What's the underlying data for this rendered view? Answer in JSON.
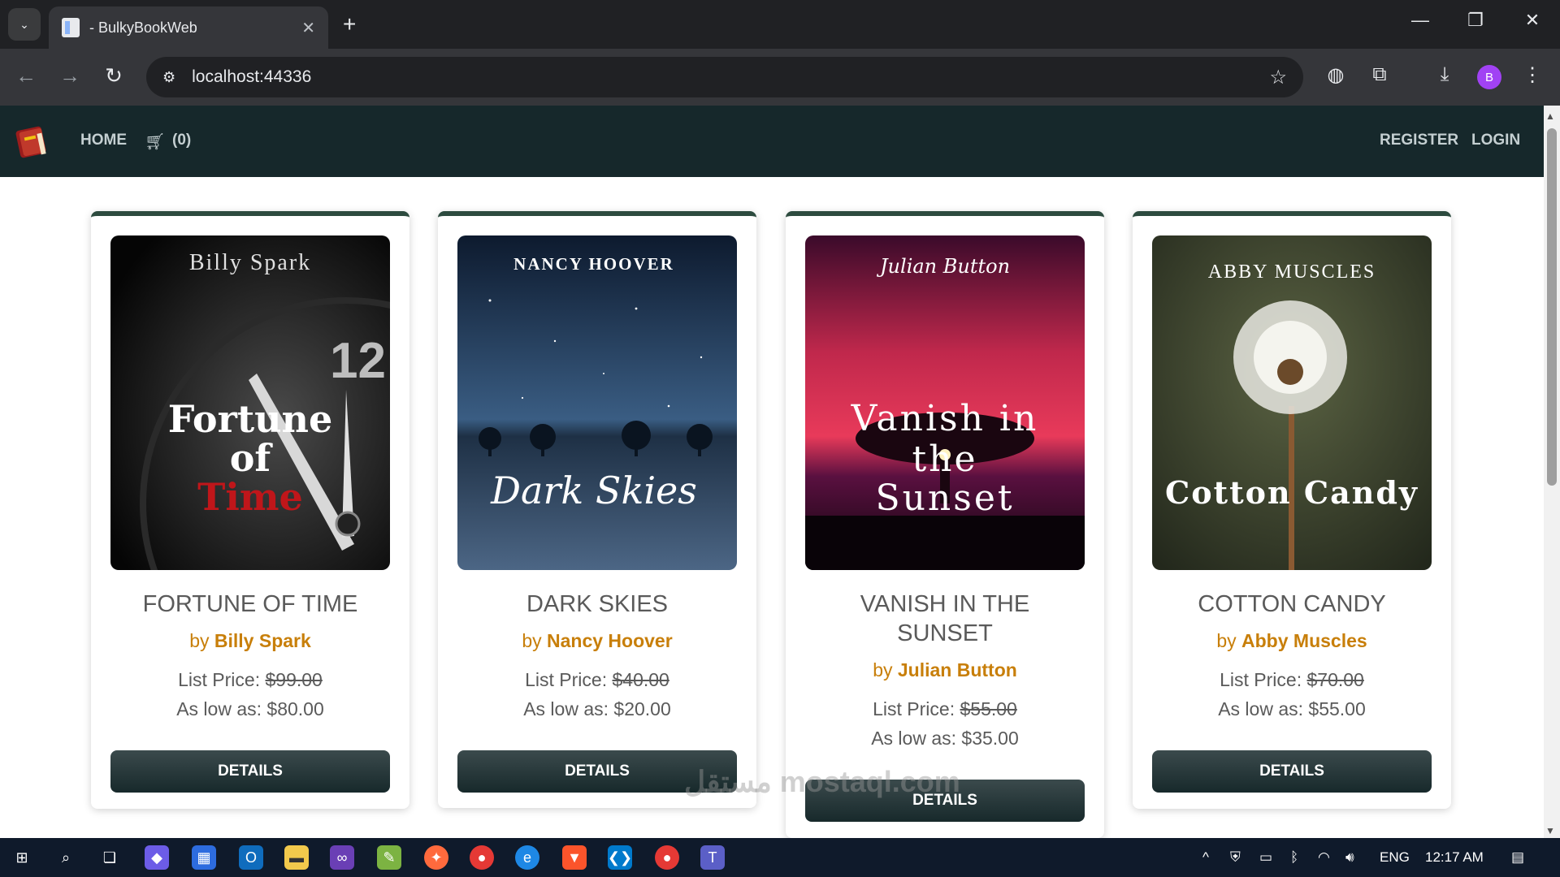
{
  "browser": {
    "tab_title": " - BulkyBookWeb",
    "url": "localhost:44336",
    "profile_initial": "B"
  },
  "nav": {
    "home": "HOME",
    "cart_count": "(0)",
    "register": "REGISTER",
    "login": "LOGIN"
  },
  "products": [
    {
      "title": "FORTUNE OF TIME",
      "by": "by",
      "author": "Billy Spark",
      "list_label": "List Price:",
      "list_price": "$99.00",
      "low_label": "As low as:",
      "low_price": "$80.00",
      "button": "DETAILS",
      "cover_author": "Billy Spark",
      "cover_title_1": "Fortune",
      "cover_title_2": "of",
      "cover_title_3": "Time"
    },
    {
      "title": "DARK SKIES",
      "by": "by",
      "author": "Nancy Hoover",
      "list_label": "List Price:",
      "list_price": "$40.00",
      "low_label": "As low as:",
      "low_price": "$20.00",
      "button": "DETAILS",
      "cover_author": "NANCY HOOVER",
      "cover_title_1": "Dark Skies"
    },
    {
      "title_line1": "VANISH IN THE",
      "title_line2": "SUNSET",
      "by": "by",
      "author": "Julian Button",
      "list_label": "List Price:",
      "list_price": "$55.00",
      "low_label": "As low as:",
      "low_price": "$35.00",
      "button": "DETAILS",
      "cover_author": "Julian Button",
      "cover_title_1": "Vanish in",
      "cover_title_2": "the",
      "cover_title_3": "Sunset"
    },
    {
      "title": "COTTON CANDY",
      "by": "by",
      "author": "Abby Muscles",
      "list_label": "List Price:",
      "list_price": "$70.00",
      "low_label": "As low as:",
      "low_price": "$55.00",
      "button": "DETAILS",
      "cover_author": "ABBY MUSCLES",
      "cover_title_1": "Cotton Candy"
    }
  ],
  "taskbar": {
    "lang": "ENG",
    "time": "12:17 AM"
  },
  "watermark": "مستقل mostaql.com",
  "colors": {
    "nav_bg": "#16282b",
    "card_accent": "#2d4b3f",
    "author_color": "#c87f0a",
    "button_bg": "#17292b"
  }
}
